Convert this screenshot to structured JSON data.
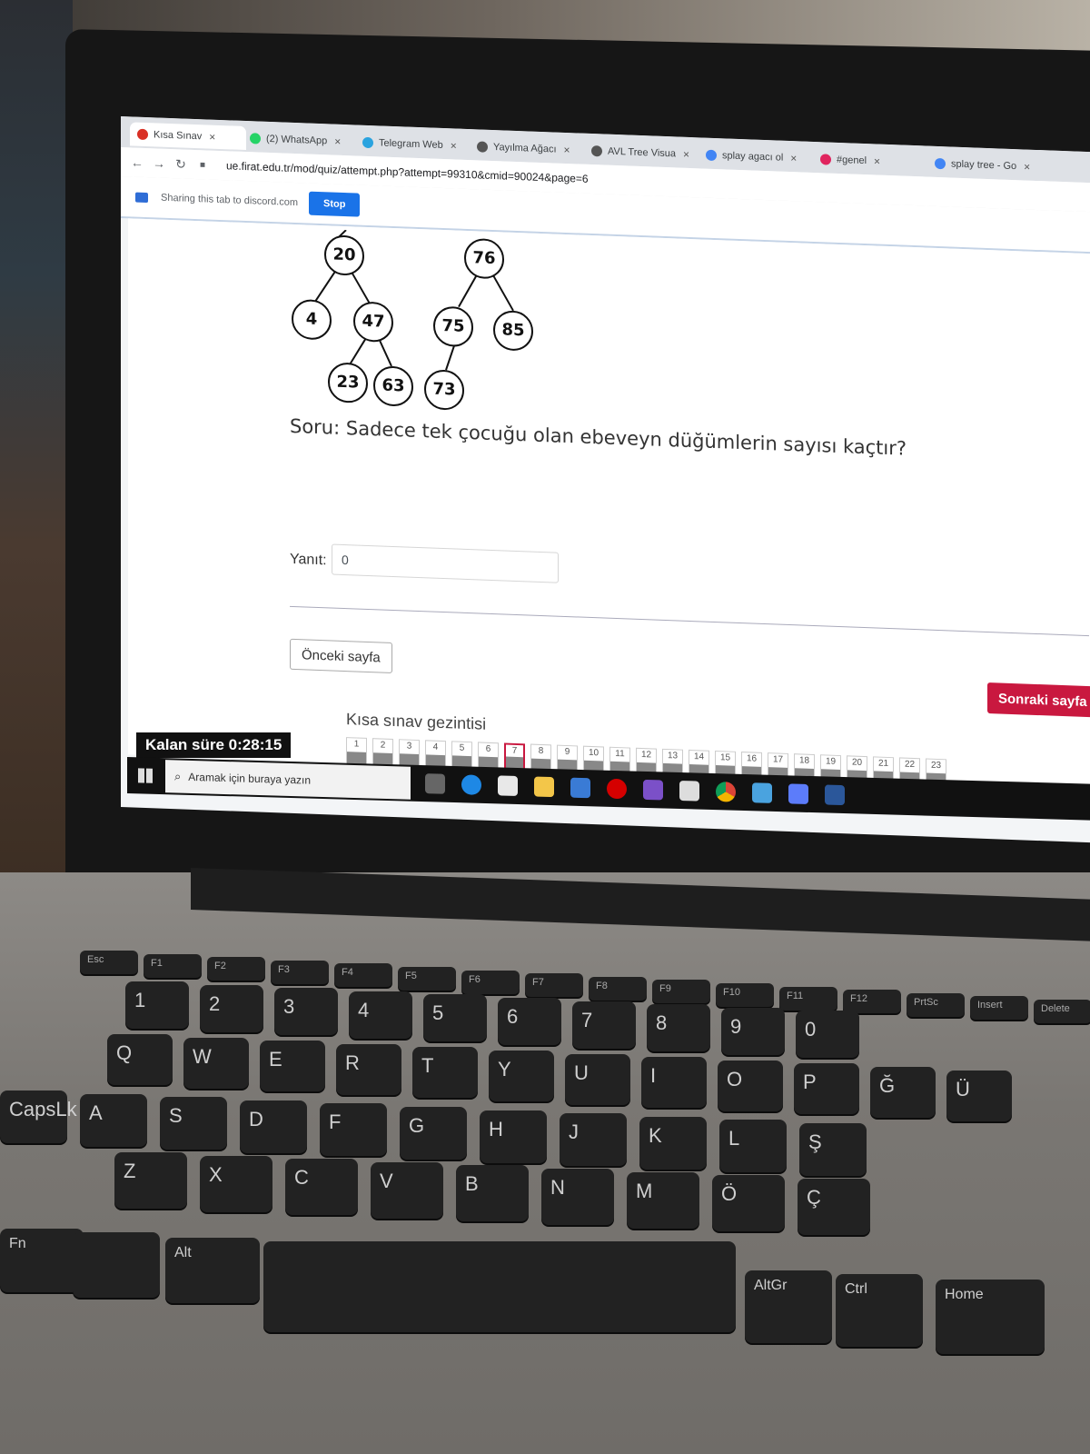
{
  "browser": {
    "tabs": [
      {
        "label": "Kısa Sınav",
        "color": "#d93025"
      },
      {
        "label": "(2) WhatsApp",
        "color": "#25d366"
      },
      {
        "label": "Telegram Web",
        "color": "#2aa3df"
      },
      {
        "label": "Yayılma Ağacı",
        "color": "#555555"
      },
      {
        "label": "AVL Tree Visua",
        "color": "#555555"
      },
      {
        "label": "splay agacı ol",
        "color": "#4285f4"
      },
      {
        "label": "#genel",
        "color": "#e0245e"
      },
      {
        "label": "splay tree - Go",
        "color": "#4285f4"
      }
    ],
    "close_glyph": "×",
    "url": "ue.firat.edu.tr/mod/quiz/attempt.php?attempt=99310&cmid=90024&page=6",
    "share_text": "Sharing this tab to discord.com",
    "stop_label": "Stop"
  },
  "tree_nodes": [
    "20",
    "76",
    "4",
    "47",
    "75",
    "85",
    "23",
    "63",
    "73"
  ],
  "question": "Soru: Sadece tek çocuğu olan ebeveyn düğümlerin sayısı kaçtır?",
  "answer": {
    "label": "Yanıt:",
    "value": "0"
  },
  "buttons": {
    "prev": "Önceki sayfa",
    "next": "Sonraki sayfa"
  },
  "navigation": {
    "title": "Kısa sınav gezintisi",
    "questions": [
      "1",
      "2",
      "3",
      "4",
      "5",
      "6",
      "7",
      "8",
      "9",
      "10",
      "11",
      "12",
      "13",
      "14",
      "15",
      "16",
      "17",
      "18",
      "19",
      "20",
      "21",
      "22",
      "23"
    ],
    "current": "7"
  },
  "timer": {
    "label": "Kalan süre",
    "value": "0:28:15"
  },
  "taskbar": {
    "search_placeholder": "Aramak için buraya yazın"
  },
  "keyboard": {
    "fn_row": [
      "Esc",
      "F1",
      "F2",
      "F3",
      "F4",
      "F5",
      "F6",
      "F7",
      "F8",
      "F9",
      "F10",
      "F11",
      "F12",
      "PrtSc",
      "Insert",
      "Delete"
    ],
    "row1": [
      "1",
      "2",
      "3",
      "4",
      "5",
      "6",
      "7",
      "8",
      "9",
      "0"
    ],
    "row2": [
      "Q",
      "W",
      "E",
      "R",
      "T",
      "Y",
      "U",
      "I",
      "O",
      "P",
      "Ğ",
      "Ü"
    ],
    "row3": [
      "CapsLk",
      "A",
      "S",
      "D",
      "F",
      "G",
      "H",
      "J",
      "K",
      "L",
      "Ş"
    ],
    "row4": [
      "Z",
      "X",
      "C",
      "V",
      "B",
      "N",
      "M",
      "Ö",
      "Ç"
    ],
    "row5": [
      "Fn",
      "Alt",
      "AltGr",
      "Ctrl",
      "Home"
    ]
  }
}
